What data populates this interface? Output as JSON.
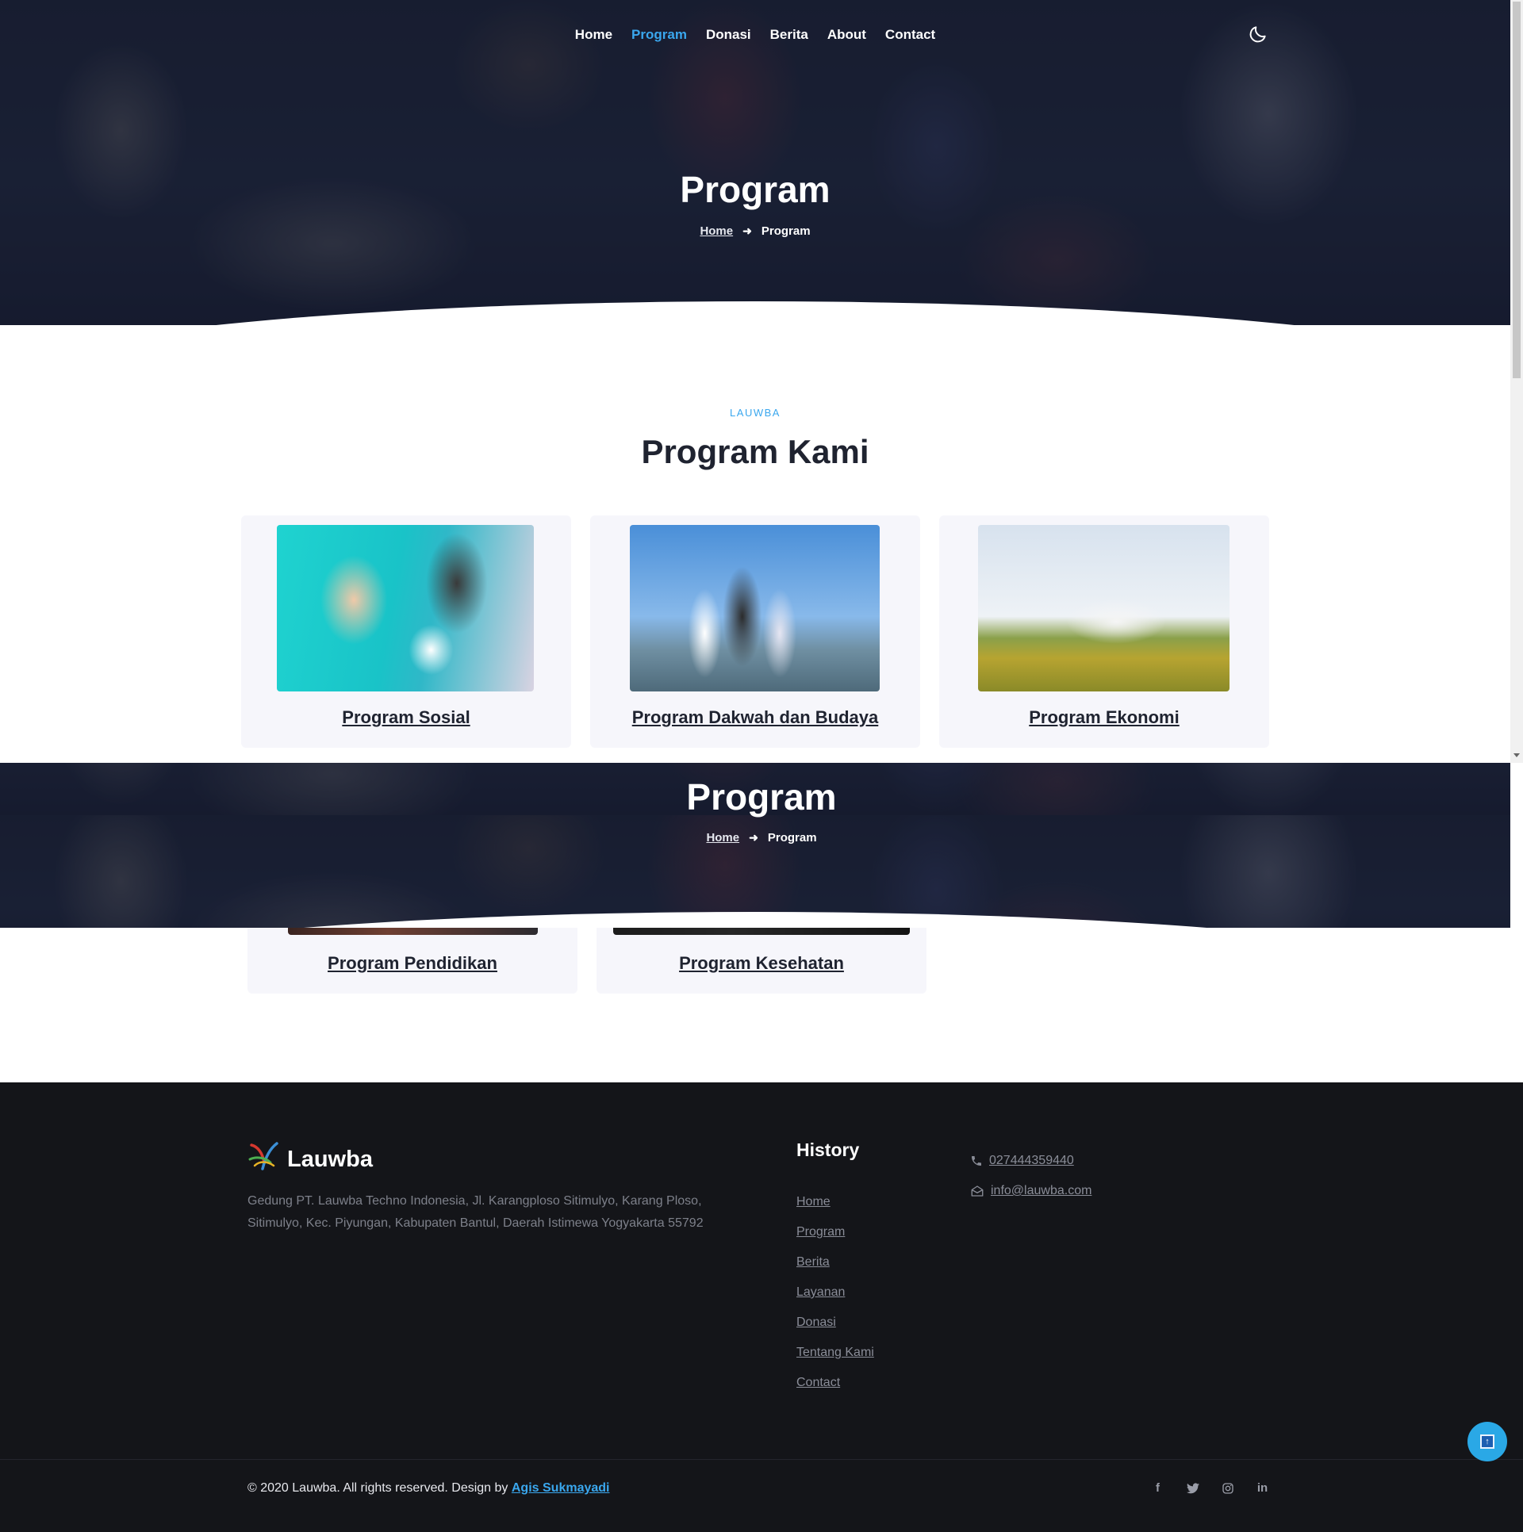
{
  "nav": {
    "items": [
      "Home",
      "Program",
      "Donasi",
      "Berita",
      "About",
      "Contact"
    ],
    "active": "Program",
    "theme_toggle_icon": "moon-icon"
  },
  "hero": {
    "title": "Program",
    "breadcrumb_home": "Home",
    "breadcrumb_current": "Program"
  },
  "section": {
    "eyebrow": "LAUWBA",
    "title": "Program Kami"
  },
  "programs": [
    {
      "title": "Program Sosial"
    },
    {
      "title": "Program Dakwah dan Budaya"
    },
    {
      "title": "Program Ekonomi"
    },
    {
      "title": "Program Pendidikan"
    },
    {
      "title": "Program Kesehatan"
    }
  ],
  "footer": {
    "brand": "Lauwba",
    "address": "Gedung PT. Lauwba Techno Indonesia, Jl. Karangploso Sitimulyo, Karang Ploso, Sitimulyo, Kec. Piyungan, Kabupaten Bantul, Daerah Istimewa Yogyakarta 55792",
    "links_heading": "History",
    "links": [
      "Home",
      "Program",
      "Berita",
      "Layanan",
      "Donasi",
      "Tentang Kami",
      "Contact"
    ],
    "phone": "027444359440",
    "email": "info@lauwba.com",
    "copyright_prefix": "© 2020 Lauwba. All rights reserved. Design by",
    "designer": "Agis Sukmayadi",
    "socials": [
      "facebook-icon",
      "twitter-icon",
      "instagram-icon",
      "linkedin-icon"
    ]
  },
  "colors": {
    "accent": "#3aa7ee",
    "footer_bg": "#141519",
    "card_bg": "#f6f6fb"
  }
}
